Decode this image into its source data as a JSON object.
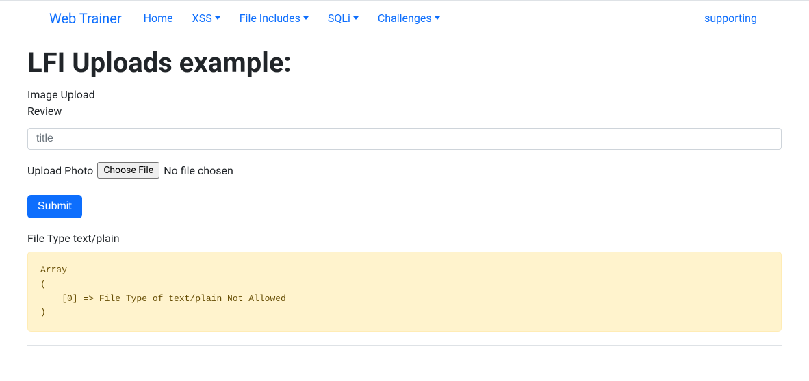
{
  "nav": {
    "brand": "Web Trainer",
    "items": [
      {
        "label": "Home",
        "dropdown": false
      },
      {
        "label": "XSS",
        "dropdown": true
      },
      {
        "label": "File Includes",
        "dropdown": true
      },
      {
        "label": "SQLi",
        "dropdown": true
      },
      {
        "label": "Challenges",
        "dropdown": true
      }
    ],
    "right": "supporting"
  },
  "page": {
    "heading": "LFI Uploads example:",
    "label1": "Image Upload",
    "label2": "Review",
    "title_placeholder": "title",
    "upload_label": "Upload Photo",
    "choose_file_button": "Choose File",
    "no_file_text": "No file chosen",
    "submit_label": "Submit",
    "file_type_line": "File Type text/plain",
    "error_output": "Array\n(\n    [0] => File Type of text/plain Not Allowed\n)"
  }
}
